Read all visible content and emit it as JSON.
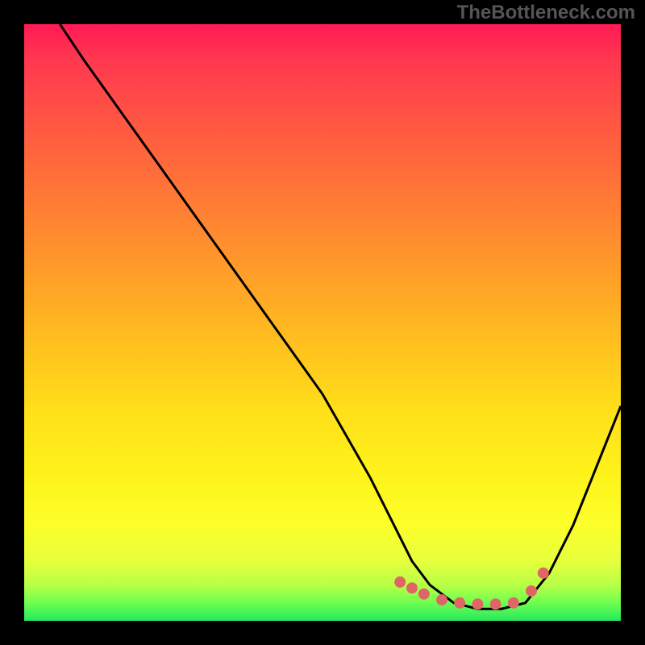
{
  "watermark": "TheBottleneck.com",
  "chart_data": {
    "type": "line",
    "title": "",
    "xlabel": "",
    "ylabel": "",
    "xlim": [
      0,
      100
    ],
    "ylim": [
      0,
      100
    ],
    "series": [
      {
        "name": "bottleneck-curve",
        "x": [
          6,
          10,
          20,
          30,
          40,
          50,
          58,
          62,
          65,
          68,
          72,
          76,
          80,
          84,
          88,
          92,
          96,
          100
        ],
        "y": [
          100,
          94,
          80,
          66,
          52,
          38,
          24,
          16,
          10,
          6,
          3,
          2,
          2,
          3,
          8,
          16,
          26,
          36
        ]
      }
    ],
    "markers": {
      "name": "highlight-dots",
      "color": "#e06666",
      "points": [
        {
          "x": 63,
          "y": 6.5
        },
        {
          "x": 65,
          "y": 5.5
        },
        {
          "x": 67,
          "y": 4.5
        },
        {
          "x": 70,
          "y": 3.5
        },
        {
          "x": 73,
          "y": 3.0
        },
        {
          "x": 76,
          "y": 2.8
        },
        {
          "x": 79,
          "y": 2.8
        },
        {
          "x": 82,
          "y": 3.0
        },
        {
          "x": 85,
          "y": 5.0
        },
        {
          "x": 87,
          "y": 8.0
        }
      ]
    }
  }
}
